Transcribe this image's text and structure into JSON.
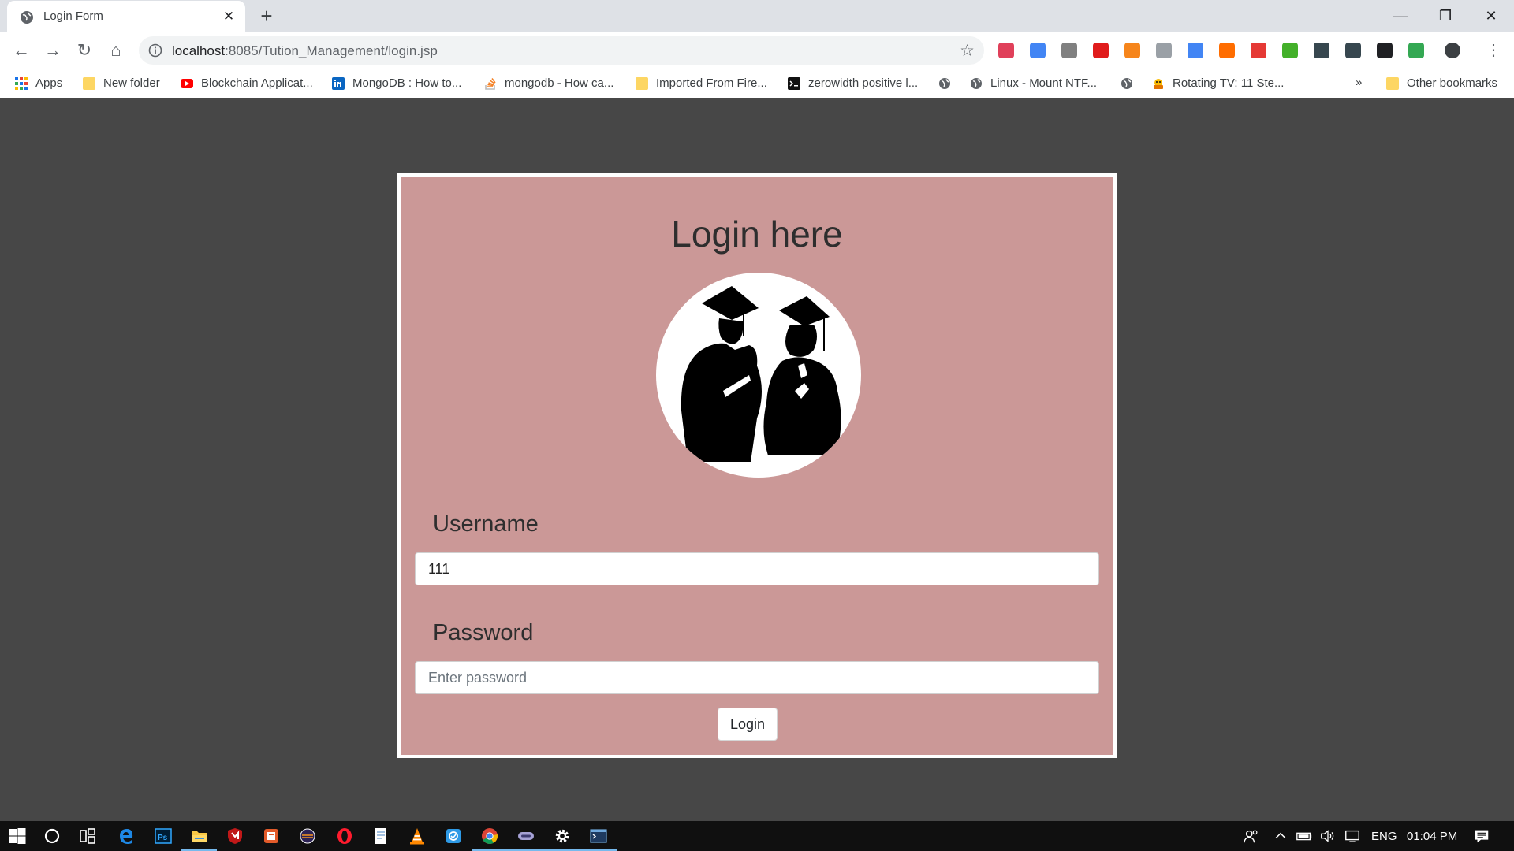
{
  "browser": {
    "tab": {
      "title": "Login Form",
      "close_glyph": "✕"
    },
    "new_tab_glyph": "+",
    "window_controls": {
      "minimize": "—",
      "maximize": "❐",
      "close": "✕"
    },
    "nav": {
      "back": "←",
      "forward": "→",
      "reload": "↻",
      "home": "⌂"
    },
    "url": {
      "host": "localhost",
      "path": ":8085/Tution_Management/login.jsp"
    },
    "star_glyph": "☆",
    "menu_glyph": "⋮",
    "extensions": [
      {
        "name": "pocket-icon",
        "color": "#e0405a"
      },
      {
        "name": "eyedropper-icon",
        "color": "#4285f4"
      },
      {
        "name": "gear-extension-icon",
        "color": "#808080"
      },
      {
        "name": "adblock-icon",
        "color": "#e01c1c"
      },
      {
        "name": "metamask-icon",
        "color": "#f6851b"
      },
      {
        "name": "keyboard-extension-icon",
        "color": "#9aa0a6"
      },
      {
        "name": "translate-icon",
        "color": "#4285f4"
      },
      {
        "name": "feed-extension-icon",
        "color": "#ff6d00"
      },
      {
        "name": "play-extension-icon",
        "color": "#e53935"
      },
      {
        "name": "selenium-icon",
        "color": "#43b02a"
      },
      {
        "name": "s-extension-icon",
        "color": "#37474f"
      },
      {
        "name": "stack-extension-icon",
        "color": "#37474f"
      },
      {
        "name": "r-extension-icon",
        "color": "#202124"
      },
      {
        "name": "globe-extension-icon",
        "color": "#34a853"
      },
      {
        "name": "profile-avatar-icon",
        "color": "#3c4043"
      }
    ],
    "bookmarks": [
      {
        "label": "Apps",
        "icon": "apps-grid-icon"
      },
      {
        "label": "New folder",
        "icon": "folder-icon"
      },
      {
        "label": "Blockchain Applicat...",
        "icon": "youtube-icon"
      },
      {
        "label": "MongoDB : How to...",
        "icon": "linkedin-icon"
      },
      {
        "label": "mongodb - How ca...",
        "icon": "stackoverflow-icon"
      },
      {
        "label": "Imported From Fire...",
        "icon": "folder-icon"
      },
      {
        "label": "zerowidth positive l...",
        "icon": "terminal-icon"
      },
      {
        "label": "",
        "icon": "globe-icon"
      },
      {
        "label": "Linux - Mount NTF...",
        "icon": "globe-icon"
      },
      {
        "label": "",
        "icon": "globe-icon"
      },
      {
        "label": "Rotating TV: 11 Ste...",
        "icon": "instructables-icon"
      }
    ],
    "bookmarks_overflow": "»",
    "other_bookmarks": "Other bookmarks"
  },
  "page": {
    "title": "Login here",
    "username_label": "Username",
    "username_value": "111",
    "password_label": "Password",
    "password_placeholder": "Enter password",
    "login_button": "Login"
  },
  "taskbar": {
    "apps": [
      "windows-start-icon",
      "cortana-icon",
      "task-view-icon",
      "edge-icon",
      "photoshop-icon",
      "file-explorer-icon",
      "mcafee-icon",
      "foxit-icon",
      "eclipse-icon",
      "opera-icon",
      "notepad-icon",
      "vlc-icon",
      "store-icon",
      "chrome-icon",
      "vs-code-icon",
      "settings-icon",
      "terminal-app-icon"
    ],
    "tray": {
      "language": "ENG",
      "time": "01:04 PM"
    }
  },
  "colors": {
    "page_background": "#474747",
    "login_box": "#cb9897",
    "login_box_border": "#ffffff"
  }
}
